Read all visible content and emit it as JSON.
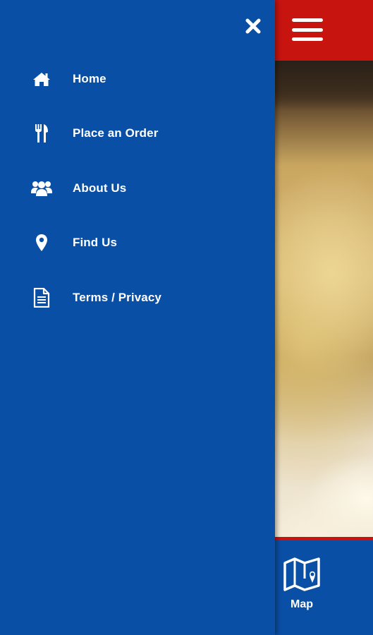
{
  "drawer": {
    "close_icon": "close-icon",
    "items": [
      {
        "label": "Home",
        "icon": "home-icon"
      },
      {
        "label": "Place an Order",
        "icon": "fork-knife-icon"
      },
      {
        "label": "About Us",
        "icon": "users-icon"
      },
      {
        "label": "Find Us",
        "icon": "map-pin-icon"
      },
      {
        "label": "Terms / Privacy",
        "icon": "document-icon"
      }
    ]
  },
  "header": {
    "menu_icon": "hamburger-icon"
  },
  "bottom_nav": {
    "items": [
      {
        "label": "Map",
        "icon": "map-icon"
      }
    ]
  },
  "colors": {
    "drawer_bg": "#0a4fa6",
    "header_bg": "#c8140f",
    "text": "#ffffff"
  }
}
